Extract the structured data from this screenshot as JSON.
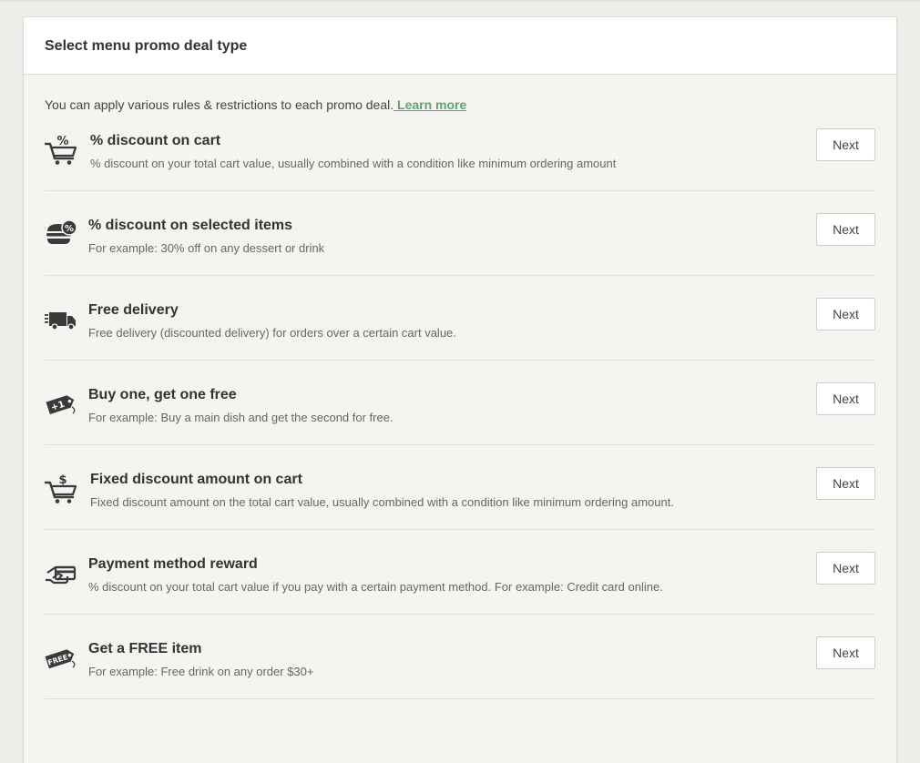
{
  "panel": {
    "title": "Select menu promo deal type",
    "intro_text": "You can apply various rules & restrictions to each promo deal.",
    "learn_more_label": " Learn more"
  },
  "deals": [
    {
      "title": "% discount on cart",
      "description": "% discount on your total cart value, usually combined with a condition like minimum ordering amount",
      "icon": "cart-percent-icon",
      "button_label": "Next"
    },
    {
      "title": "% discount on selected items",
      "description": "For example: 30% off on any dessert or drink",
      "icon": "burger-percent-icon",
      "button_label": "Next"
    },
    {
      "title": "Free delivery",
      "description": "Free delivery (discounted delivery) for orders over a certain cart value.",
      "icon": "delivery-truck-icon",
      "button_label": "Next"
    },
    {
      "title": "Buy one, get one free",
      "description": "For example: Buy a main dish and get the second for free.",
      "icon": "plus-one-tag-icon",
      "tag_text": "+1",
      "button_label": "Next"
    },
    {
      "title": "Fixed discount amount on cart",
      "description": "Fixed discount amount on the total cart value, usually combined with a condition like minimum ordering amount.",
      "icon": "cart-dollar-icon",
      "button_label": "Next"
    },
    {
      "title": "Payment method reward",
      "description": "% discount on your total cart value if you pay with a certain payment method. For example: Credit card online.",
      "icon": "hand-card-icon",
      "button_label": "Next"
    },
    {
      "title": "Get a FREE item",
      "description": "For example: Free drink on any order $30+",
      "icon": "free-tag-icon",
      "tag_text": "FREE",
      "button_label": "Next"
    }
  ],
  "colors": {
    "page_bg": "#efeeea",
    "panel_bg": "#f5f4f1",
    "header_bg": "#ffffff",
    "link": "#5aa86b",
    "icon": "#3a3a3a"
  }
}
